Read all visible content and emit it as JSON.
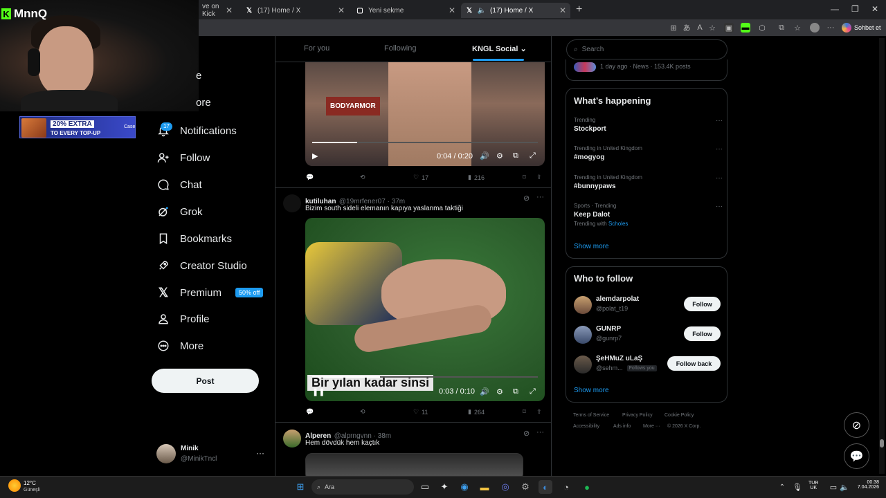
{
  "browser": {
    "tabs": [
      {
        "label": "ve on Kick",
        "active": false
      },
      {
        "label": "(17) Home / X",
        "active": false
      },
      {
        "label": "Yeni sekme",
        "active": false
      },
      {
        "label": "(17) Home / X",
        "active": true
      }
    ],
    "new_tab": "+",
    "chat_label": "Sohbet et",
    "window_controls": [
      "minimize-icon",
      "restore-icon",
      "close-icon"
    ]
  },
  "stream": {
    "logo": "MnnQ",
    "logo_mark": "K",
    "ad": {
      "headline": "20% EXTRA",
      "sub": "TO EVERY TOP-UP",
      "brand": "Case"
    }
  },
  "nav": {
    "items": [
      {
        "label": "Home",
        "partial": "e",
        "icon": "home-icon"
      },
      {
        "label": "Explore",
        "partial": "ore",
        "icon": "search-icon"
      },
      {
        "label": "Notifications",
        "icon": "bell-icon",
        "badge": "17"
      },
      {
        "label": "Follow",
        "icon": "person-add-icon"
      },
      {
        "label": "Chat",
        "icon": "chat-icon"
      },
      {
        "label": "Grok",
        "icon": "grok-icon"
      },
      {
        "label": "Bookmarks",
        "icon": "bookmark-icon"
      },
      {
        "label": "Creator Studio",
        "icon": "rocket-icon"
      },
      {
        "label": "Premium",
        "icon": "x-icon",
        "badge": "50% off"
      },
      {
        "label": "Profile",
        "icon": "profile-icon"
      },
      {
        "label": "More",
        "icon": "more-circle-icon"
      }
    ],
    "post_button": "Post",
    "account": {
      "name": "Minik",
      "handle": "@MinikTncl"
    }
  },
  "timeline": {
    "tabs": [
      "For you",
      "Following",
      "KNGL Social"
    ],
    "active_tab": "KNGL Social",
    "tweet1": {
      "video_time": "0:04 / 0:20",
      "overlay_brand": "BODYARMOR",
      "replies": "",
      "retweets": "",
      "likes": "17",
      "views": "216"
    },
    "tweet2": {
      "name": "kutiluhan",
      "handle": "@19mrfener07",
      "time": "37m",
      "text": "Bizim south sideli elemanın kapıya yaslanma taktiği",
      "caption": "Bir yılan kadar sinsi",
      "video_time": "0:03 / 0:10",
      "likes": "11",
      "views": "264"
    },
    "tweet3": {
      "name": "Alperen",
      "handle": "@alprngvnn",
      "time": "38m",
      "text": "Hem dövdük hem kaçtık"
    }
  },
  "sidebar": {
    "search_placeholder": "Search",
    "news_meta": "1 day ago · News · 153.4K posts",
    "happening": {
      "title": "What’s happening",
      "trends": [
        {
          "context": "Trending",
          "name": "Stockport"
        },
        {
          "context": "Trending in United Kingdom",
          "name": "#mogyog"
        },
        {
          "context": "Trending in United Kingdom",
          "name": "#bunnypaws"
        },
        {
          "context": "Sports · Trending",
          "name": "Keep Dalot",
          "extra_prefix": "Trending with",
          "extra_link": "Scholes"
        }
      ],
      "show_more": "Show more"
    },
    "who_to_follow": {
      "title": "Who to follow",
      "accounts": [
        {
          "name": "alemdarpolat",
          "handle": "@polat_t19",
          "button": "Follow"
        },
        {
          "name": "GUNRP",
          "handle": "@gunrp7",
          "button": "Follow"
        },
        {
          "name": "ŞeHMuZ uLaŞ",
          "handle": "@sehm...",
          "follows_you": "Follows you",
          "button": "Follow back"
        }
      ],
      "show_more": "Show more"
    },
    "footer": [
      "Terms of Service",
      "Privacy Policy",
      "Cookie Policy",
      "Accessibility",
      "Ads info",
      "More ···",
      "© 2026 X Corp."
    ]
  },
  "taskbar": {
    "weather_temp": "12°C",
    "weather_desc": "Güneşli",
    "search": "Ara",
    "lang1": "TUR",
    "lang2": "UK",
    "time": "00:38",
    "date": "7.04.2026"
  },
  "colors": {
    "accent": "#1d9bf0",
    "bg": "#000000",
    "border": "#2f3336",
    "muted": "#71767b",
    "kick": "#53fc18"
  }
}
